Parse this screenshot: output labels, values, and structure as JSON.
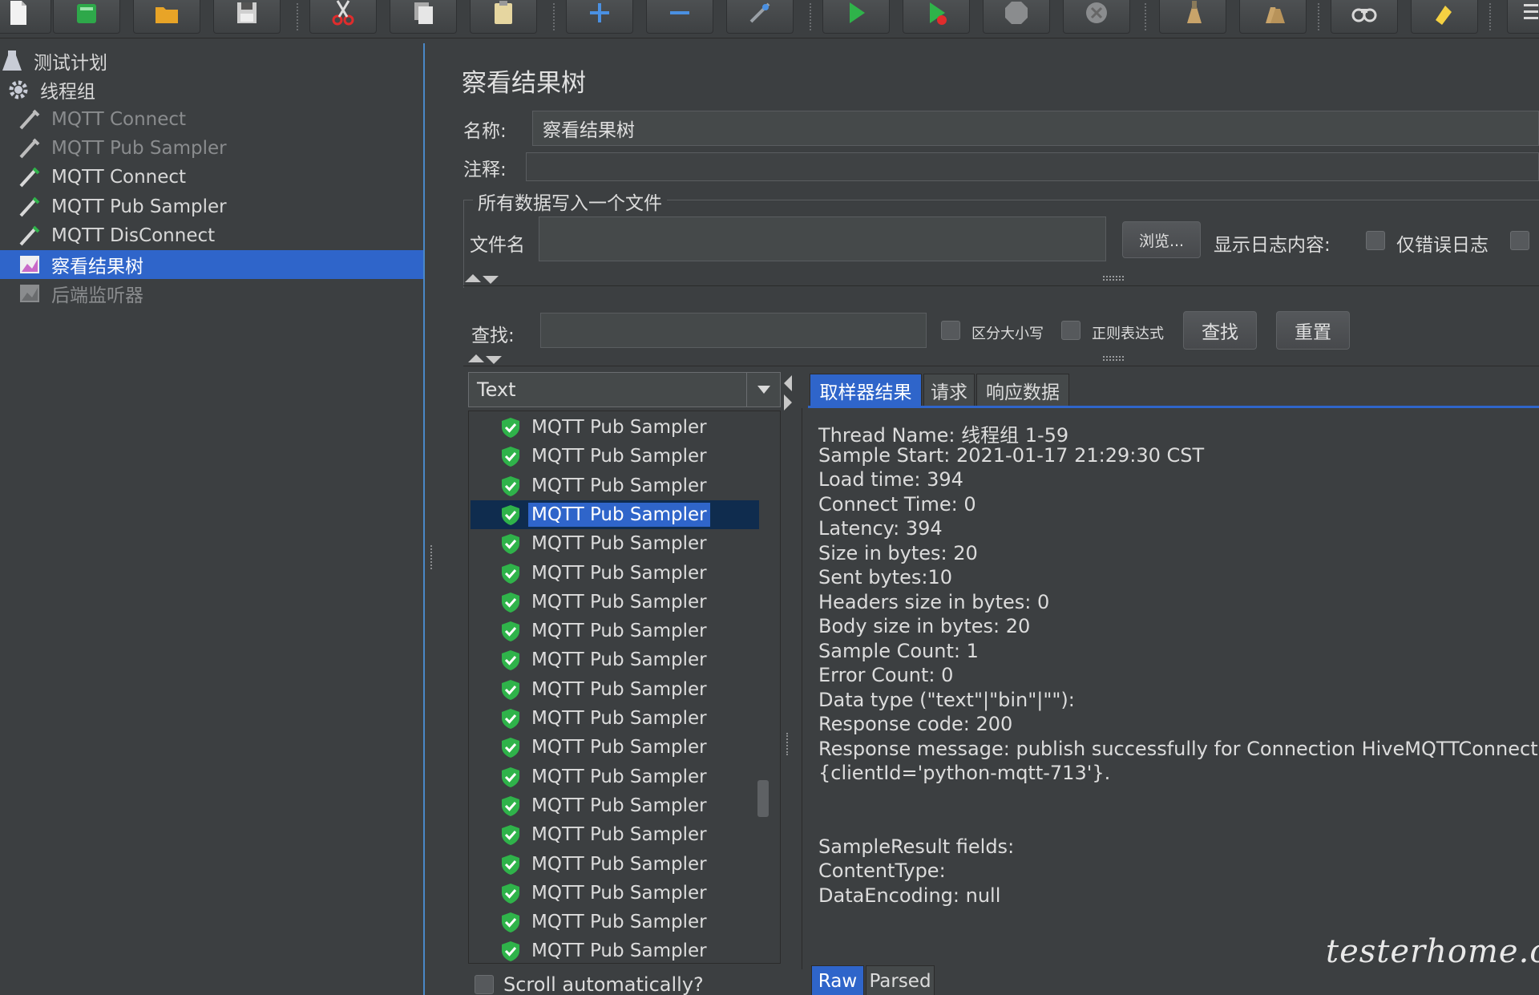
{
  "toolbar": {
    "buttons": [
      {
        "name": "new-icon",
        "color": "#f2f2f2"
      },
      {
        "name": "templates-icon",
        "color": "#2ea84a"
      },
      {
        "name": "open-icon",
        "color": "#e8a427"
      },
      {
        "name": "save-icon",
        "color": "#cfcfcf"
      },
      {
        "name": "cut-icon",
        "color": "#e02c2c"
      },
      {
        "name": "copy-icon",
        "color": "#e6e6e6"
      },
      {
        "name": "paste-icon",
        "color": "#e6d6a0"
      },
      {
        "name": "expand-icon",
        "color": "#4a90e2"
      },
      {
        "name": "collapse-icon",
        "color": "#4a90e2"
      },
      {
        "name": "toggle-icon",
        "color": "#9aa0a6"
      },
      {
        "name": "start-icon",
        "color": "#2fb34a"
      },
      {
        "name": "start-no-pause-icon",
        "color": "#2fb34a"
      },
      {
        "name": "stop-icon",
        "color": "#8a8c8e"
      },
      {
        "name": "shutdown-icon",
        "color": "#8a8c8e"
      },
      {
        "name": "clear-icon",
        "color": "#c9a46a"
      },
      {
        "name": "clear-all-icon",
        "color": "#c9a46a"
      },
      {
        "name": "search-icon",
        "color": "#d8d8d8"
      },
      {
        "name": "reset-search-icon",
        "color": "#f5d142"
      },
      {
        "name": "function-helper-icon",
        "color": "#d8d8d8"
      }
    ]
  },
  "tree": {
    "items": [
      {
        "label": "测试计划",
        "icon": "test-plan-icon",
        "indent": 0,
        "state": "normal"
      },
      {
        "label": "线程组",
        "icon": "thread-group-icon",
        "indent": 1,
        "state": "normal"
      },
      {
        "label": "MQTT Connect",
        "icon": "sampler-icon",
        "indent": 2,
        "state": "disabled"
      },
      {
        "label": "MQTT Pub Sampler",
        "icon": "sampler-icon",
        "indent": 2,
        "state": "disabled"
      },
      {
        "label": "MQTT Connect",
        "icon": "sampler-icon",
        "indent": 2,
        "state": "normal"
      },
      {
        "label": "MQTT Pub Sampler",
        "icon": "sampler-icon",
        "indent": 2,
        "state": "normal"
      },
      {
        "label": "MQTT DisConnect",
        "icon": "sampler-icon",
        "indent": 2,
        "state": "normal"
      },
      {
        "label": "察看结果树",
        "icon": "listener-icon",
        "indent": 2,
        "state": "selected"
      },
      {
        "label": "后端监听器",
        "icon": "listener-icon",
        "indent": 2,
        "state": "disabled"
      }
    ]
  },
  "panel": {
    "title": "察看结果树",
    "name_label": "名称:",
    "name_value": "察看结果树",
    "comment_label": "注释:",
    "comment_value": "",
    "file_group_title": "所有数据写入一个文件",
    "filename_label": "文件名",
    "filename_value": "",
    "browse_label": "浏览...",
    "log_content_label": "显示日志内容:",
    "errors_only_label": "仅错误日志",
    "search_label": "查找:",
    "search_value": "",
    "case_sensitive_label": "区分大小写",
    "regex_label": "正则表达式",
    "find_button": "查找",
    "reset_button": "重置"
  },
  "renderer": {
    "selected": "Text"
  },
  "results": {
    "item_label": "MQTT Pub Sampler",
    "count": 19,
    "selected_index": 3,
    "scroll_auto_label": "Scroll automatically?"
  },
  "tabs": [
    {
      "label": "取样器结果",
      "active": true
    },
    {
      "label": "请求",
      "active": false
    },
    {
      "label": "响应数据",
      "active": false
    }
  ],
  "detail": {
    "lines": [
      "Thread Name: 线程组 1-59",
      "Sample Start: 2021-01-17 21:29:30 CST",
      "Load time: 394",
      "Connect Time: 0",
      "Latency: 394",
      "Size in bytes: 20",
      "Sent bytes:10",
      "Headers size in bytes: 0",
      "Body size in bytes: 20",
      "Sample Count: 1",
      "Error Count: 0",
      "Data type (\"text\"|\"bin\"|\"\"):",
      "Response code: 200",
      "Response message: publish successfully for Connection HiveMQTTConnection",
      "{clientId='python-mqtt-713'}.",
      "",
      "",
      "SampleResult fields:",
      "ContentType:",
      "DataEncoding: null"
    ]
  },
  "bottom_tabs": [
    {
      "label": "Raw",
      "active": true
    },
    {
      "label": "Parsed",
      "active": false
    }
  ],
  "watermark": "testerhome.com",
  "colors": {
    "selection": "#2f65ca",
    "background": "#3c3f41",
    "success": "#2fb34a"
  }
}
